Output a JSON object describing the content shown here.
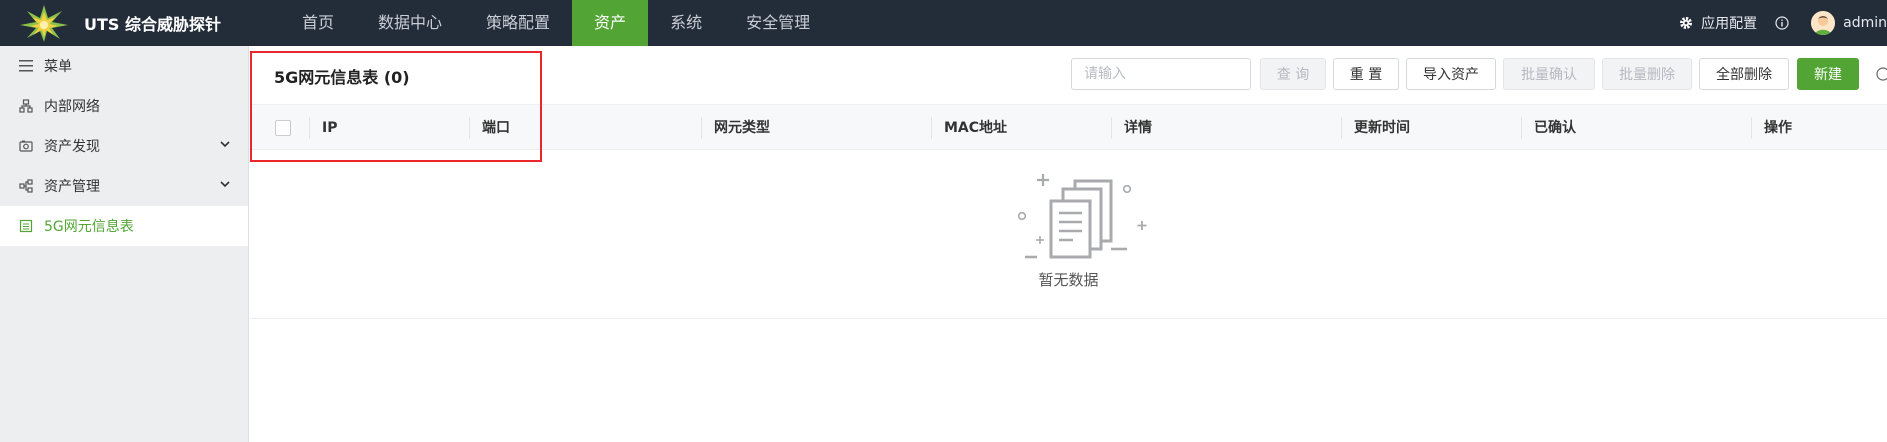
{
  "app": {
    "title": "UTS 综合威胁探针"
  },
  "nav": {
    "items": [
      {
        "label": "首页"
      },
      {
        "label": "数据中心"
      },
      {
        "label": "策略配置"
      },
      {
        "label": "资产"
      },
      {
        "label": "系统"
      },
      {
        "label": "安全管理"
      }
    ],
    "active_index": 3
  },
  "topright": {
    "config_label": "应用配置",
    "user": "admin"
  },
  "sidebar": {
    "items": [
      {
        "label": "菜单",
        "icon": "menu-icon"
      },
      {
        "label": "内部网络",
        "icon": "network-icon"
      },
      {
        "label": "资产发现",
        "icon": "discovery-icon",
        "expandable": true
      },
      {
        "label": "资产管理",
        "icon": "asset-tree-icon",
        "expandable": true
      },
      {
        "label": "5G网元信息表",
        "icon": "table-icon",
        "active": true
      }
    ]
  },
  "main": {
    "title": "5G网元信息表 (0)",
    "search": {
      "placeholder": "请输入",
      "value": ""
    },
    "buttons": {
      "query": "查 询",
      "reset": "重 置",
      "import": "导入资产",
      "batch_confirm": "批量确认",
      "batch_delete": "批量删除",
      "delete_all": "全部删除",
      "create": "新建"
    },
    "columns": [
      "IP",
      "端口",
      "网元类型",
      "MAC地址",
      "详情",
      "更新时间",
      "已确认",
      "操作"
    ],
    "rows": [],
    "empty_text": "暂无数据"
  },
  "colors": {
    "accent": "#52a534",
    "topbar": "#232c39",
    "highlight": "#e8262c"
  }
}
